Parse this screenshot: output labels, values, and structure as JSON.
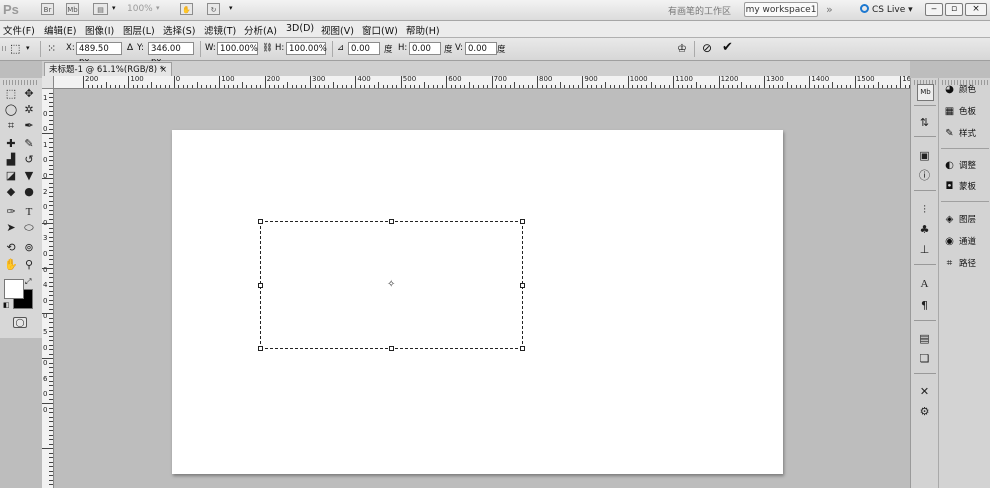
{
  "app": {
    "logo": "Ps",
    "zoom_display": "100%",
    "workspace_plain": "有画笔的工作区",
    "workspace_active": "my workspace1",
    "more_glyph": "»",
    "cs_live": "CS Live",
    "cs_live_caret": "▾"
  },
  "menu": [
    "文件(F)",
    "编辑(E)",
    "图像(I)",
    "图层(L)",
    "选择(S)",
    "滤镜(T)",
    "分析(A)",
    "3D(D)",
    "视图(V)",
    "窗口(W)",
    "帮助(H)"
  ],
  "options": {
    "x_label": "X:",
    "x_value": "489.50 px",
    "y_label": "Y:",
    "y_value": "346.00 px",
    "w_label": "W:",
    "w_value": "100.00%",
    "h_label": "H:",
    "h_value": "100.00%",
    "angle_value": "0.00",
    "angle_unit": "度",
    "hskew_label": "H:",
    "hskew_value": "0.00",
    "hskew_unit": "度",
    "vskew_label": "V:",
    "vskew_value": "0.00",
    "vskew_unit": "度"
  },
  "document": {
    "tab_title": "未标题-1 @ 61.1%(RGB/8) *",
    "close_glyph": "×"
  },
  "ruler": {
    "h_labels": [
      "200",
      "100",
      "0",
      "100",
      "200",
      "300",
      "400",
      "500",
      "600",
      "700",
      "800",
      "900",
      "1000",
      "1100",
      "1200",
      "1300",
      "1400",
      "1500",
      "160"
    ],
    "v_labels": [
      "1",
      "0",
      "0",
      "1",
      "0",
      "0",
      "2",
      "0",
      "0",
      "3",
      "0",
      "0",
      "4",
      "0",
      "0",
      "5",
      "0",
      "0",
      "6",
      "0",
      "0"
    ]
  },
  "panels": [
    {
      "icon": "◕",
      "label": "颜色"
    },
    {
      "icon": "▦",
      "label": "色板"
    },
    {
      "icon": "✎",
      "label": "样式"
    },
    {
      "icon": "◐",
      "label": "调整"
    },
    {
      "icon": "◘",
      "label": "蒙板"
    },
    {
      "icon": "◈",
      "label": "图层"
    },
    {
      "icon": "◉",
      "label": "通道"
    },
    {
      "icon": "⌗",
      "label": "路径"
    }
  ],
  "colors": {
    "foreground": "#ffffff",
    "background": "#000000",
    "accent": "#1d78d0"
  }
}
